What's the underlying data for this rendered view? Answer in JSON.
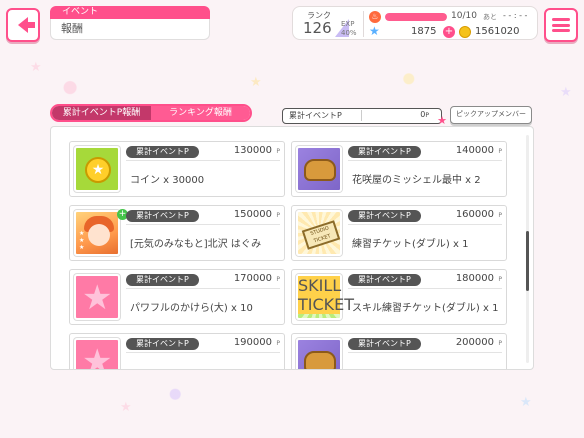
{
  "header": {
    "category": "イベント",
    "title": "報酬",
    "rank_label": "ランク",
    "rank_value": "126",
    "exp_label": "EXP",
    "exp_pct": "40%",
    "life_count": "10/10",
    "life_suffix": "あと",
    "life_timer": "- - : - -",
    "gems": "1875",
    "coins": "1561020"
  },
  "tabs": [
    {
      "label": "累計イベントP報酬",
      "active": true
    },
    {
      "label": "ランキング報酬",
      "active": false
    }
  ],
  "points": {
    "label": "累計イベントP",
    "value": "0",
    "unit": "P"
  },
  "pickup_button": "ピックアップメンバー",
  "rewards": [
    {
      "category": "累計イベントP",
      "points": "130000",
      "unit": "P",
      "name": "コイン x 30000",
      "icon": "coin-icon"
    },
    {
      "category": "累計イベントP",
      "points": "140000",
      "unit": "P",
      "name": "花咲屋のミッシェル最中 x 2",
      "icon": "bread-icon"
    },
    {
      "category": "累計イベントP",
      "points": "150000",
      "unit": "P",
      "name": "[元気のみなもと]北沢 はぐみ",
      "icon": "character-card-icon"
    },
    {
      "category": "累計イベントP",
      "points": "160000",
      "unit": "P",
      "name": "練習チケット(ダブル) x 1",
      "icon": "studio-ticket-icon"
    },
    {
      "category": "累計イベントP",
      "points": "170000",
      "unit": "P",
      "name": "パワフルのかけら(大) x 10",
      "icon": "star-shard-icon"
    },
    {
      "category": "累計イベントP",
      "points": "180000",
      "unit": "P",
      "name": "スキル練習チケット(ダブル) x 1",
      "icon": "skill-ticket-icon"
    },
    {
      "category": "累計イベントP",
      "points": "190000",
      "unit": "P",
      "name": "",
      "icon": "star-shard-icon"
    },
    {
      "category": "累計イベントP",
      "points": "200000",
      "unit": "P",
      "name": "",
      "icon": "bread-icon"
    }
  ],
  "ticket_text": {
    "studio": "STUDIO TICKET",
    "skill": "SKILL TICKET"
  },
  "colors": {
    "accent": "#ff4f8b",
    "badge": "#555555",
    "tab_active": "#c3386a"
  }
}
